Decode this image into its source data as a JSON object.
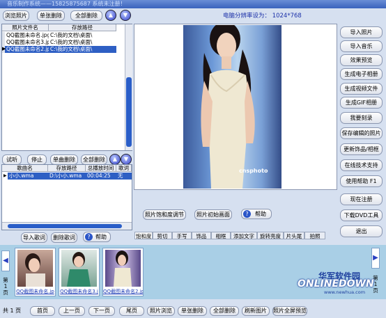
{
  "title": "音乐制作系统——15825875687  系统未注册！",
  "resolution_text": "电脑分辨率设为： 1024*768",
  "top_toolbar": {
    "browse": "浏览照片",
    "delete_single": "单张删除",
    "delete_all": "全部删除"
  },
  "photo_list": {
    "columns": [
      "照片文件名",
      "存放路径"
    ],
    "rows": [
      {
        "name": "QQ截图未命名.jpg",
        "path": "C:\\我的文档\\桌面\\"
      },
      {
        "name": "QQ截图未命名3.jp",
        "path": "C:\\我的文档\\桌面\\"
      },
      {
        "name": "QQ截图未命名2.jp",
        "path": "C:\\我的文档\\桌面\\"
      }
    ],
    "right_col": [
      "QQ截图未命",
      "QQ截图未命",
      "QQ截图未命"
    ]
  },
  "music_controls": {
    "listen": "试听",
    "stop": "停止",
    "delete_single": "单曲删除",
    "delete_all": "全部删除"
  },
  "music_list": {
    "columns": [
      "歌曲名",
      "存放路径",
      "总播放时间",
      "歌词"
    ],
    "rows": [
      {
        "marker": "▶",
        "name": "小小.wma",
        "path": "D:\\小小.wma",
        "time": "00:04:25",
        "lyrics": "无"
      }
    ]
  },
  "lyrics_buttons": {
    "import": "导入歌词",
    "delete": "删除歌词",
    "help": "帮助"
  },
  "preview": {
    "watermark": "cnsphoto"
  },
  "photo_buttons": {
    "brightness": "照片饱和度调节",
    "init": "照片初始画面",
    "help": "帮助"
  },
  "tabs": [
    "饱和度",
    "剪切",
    "手写",
    "饰品",
    "相框",
    "添加文字",
    "旋转亮度",
    "片头尾",
    "拍照"
  ],
  "right_buttons": [
    "导入照片",
    "导入音乐",
    "效果预览",
    "生成电子相册",
    "生成视频文件",
    "生成GIF相册",
    "我要刻录",
    "保存编辑的照片",
    "更新饰品/相框",
    "在线技术支持",
    "使用帮助  F1",
    "现在注册",
    "下载DVD工具",
    "退出"
  ],
  "thumbnails": {
    "captions": [
      "QQ截图未命名.jp",
      "QQ截图未命名3.j",
      "QQ截图未命名2.jp"
    ],
    "page_left": "第1页",
    "page_right": "第1页"
  },
  "logo": {
    "line1": "华军软件园",
    "line2": "ONLINEDOWN",
    "line3": "www.newhua.com"
  },
  "footer": {
    "total": "共 1 页",
    "buttons": [
      "首页",
      "上一页",
      "下一页",
      "尾页",
      "照片浏览",
      "单张删除",
      "全部删除",
      "刷新图片",
      "照片全屏预览"
    ]
  },
  "colors": {
    "accent": "#2e5fc4",
    "thumb_bg": "#a9cfe6"
  },
  "icons": [
    "arrow-up-icon",
    "arrow-down-icon",
    "help-icon",
    "arrow-left-icon",
    "arrow-right-icon"
  ]
}
